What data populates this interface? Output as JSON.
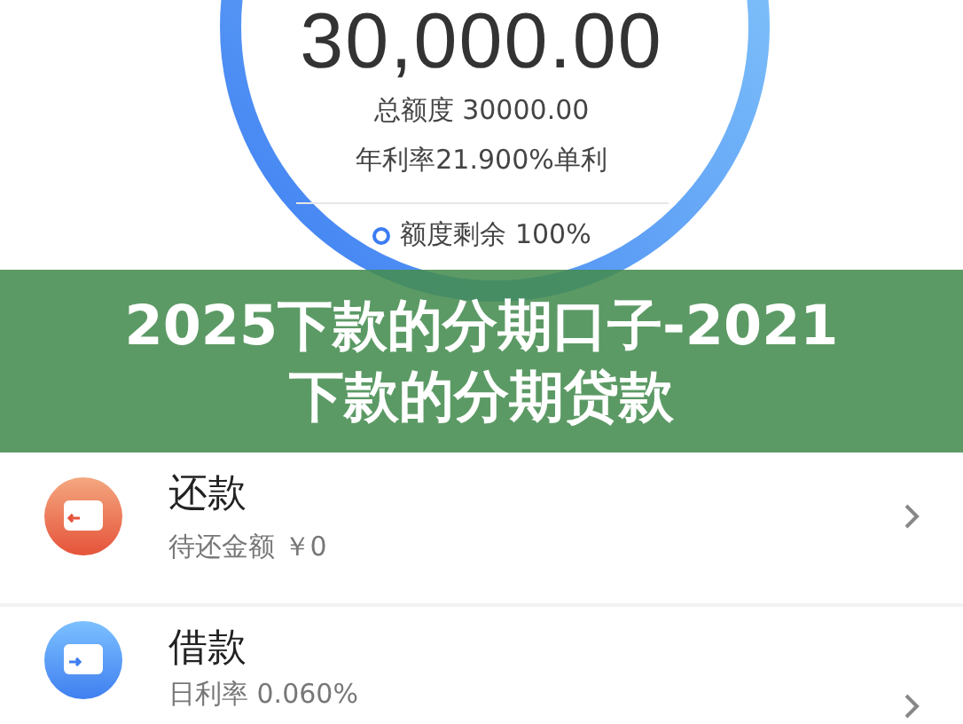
{
  "credit": {
    "amount": "30,000.00",
    "total_limit": "总额度 30000.00",
    "rate": "年利率21.900%单利",
    "remaining": "额度剩余 100%"
  },
  "banner": {
    "lines": [
      "2025下款的分期口子-2021",
      "下款的分期贷款"
    ]
  },
  "items": [
    {
      "kind": "repay",
      "title": "还款",
      "subtitle": "待还金额 ￥0"
    },
    {
      "kind": "borrow",
      "title": "借款",
      "subtitle": "日利率 0.060%"
    }
  ]
}
